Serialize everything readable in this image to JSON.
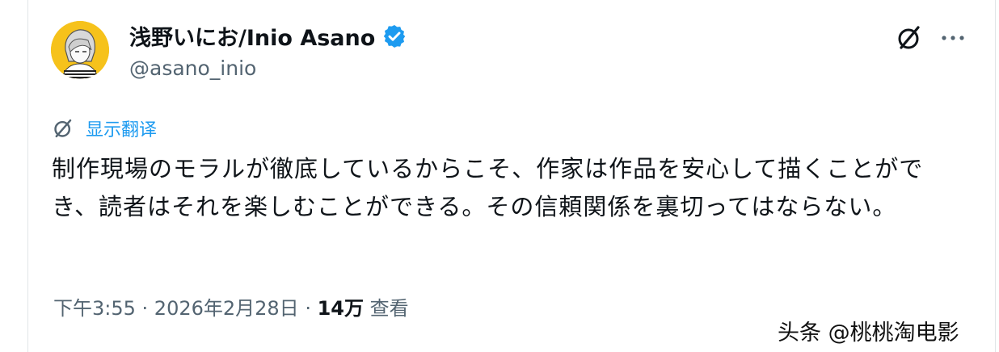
{
  "author": {
    "display_name": "浅野いにお/Inio Asano",
    "handle": "@asano_inio",
    "verified": true
  },
  "header": {
    "grok_icon": "grok-icon",
    "more_icon": "more-dots-icon"
  },
  "translate": {
    "label": "显示翻译"
  },
  "tweet": {
    "text": "制作現場のモラルが徹底しているからこそ、作家は作品を安心して描くことができ、読者はそれを楽しむことができる。その信頼関係を裏切ってはならない。"
  },
  "meta": {
    "time": "下午3:55",
    "sep1": " · ",
    "date": "2026年2月28日",
    "sep2": " · ",
    "views_count": "14万",
    "views_label": " 查看"
  },
  "watermark": {
    "text": "头条 @桃桃淘电影"
  },
  "colors": {
    "accent": "#1d9bf0",
    "text": "#0f1419",
    "secondary": "#536471",
    "avatar_bg": "#f6c21b"
  }
}
